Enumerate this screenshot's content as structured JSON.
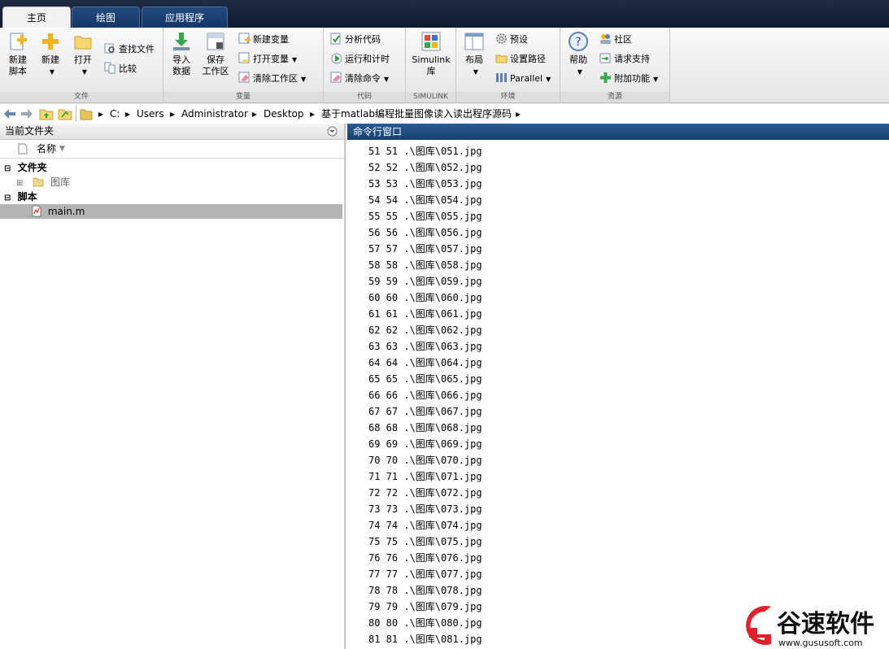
{
  "tabs": [
    {
      "label": "主页",
      "active": true
    },
    {
      "label": "绘图",
      "active": false
    },
    {
      "label": "应用程序",
      "active": false
    }
  ],
  "ribbon": {
    "file": {
      "group_label": "文件",
      "new_script": "新建\n脚本",
      "new": "新建",
      "open": "打开",
      "find_files": "查找文件",
      "compare": "比较"
    },
    "variable": {
      "group_label": "变量",
      "import_data": "导入\n数据",
      "save_workspace": "保存\n工作区",
      "new_variable": "新建变量",
      "open_variable": "打开变量",
      "clear_workspace": "清除工作区"
    },
    "code": {
      "group_label": "代码",
      "analyze_code": "分析代码",
      "run_and_time": "运行和计时",
      "clear_commands": "清除命令"
    },
    "simulink": {
      "group_label": "SIMULINK",
      "simulink_library": "Simulink\n库"
    },
    "environment": {
      "group_label": "环境",
      "layout": "布局",
      "preferences": "预设",
      "set_path": "设置路径",
      "parallel": "Parallel"
    },
    "resources": {
      "group_label": "资源",
      "help": "帮助",
      "community": "社区",
      "request_support": "请求支持",
      "add_ons": "附加功能"
    }
  },
  "address": {
    "crumbs": [
      "C:",
      "Users",
      "Administrator",
      "Desktop",
      "基于matlab编程批量图像读入读出程序源码"
    ]
  },
  "current_folder": {
    "title": "当前文件夹",
    "column_name": "名称",
    "section_folders": "文件夹",
    "folder_item": "图库",
    "section_scripts": "脚本",
    "script_item": "main.m"
  },
  "command_window": {
    "title": "命令行窗口",
    "lines": [
      "51 51 .\\图库\\051.jpg",
      "52 52 .\\图库\\052.jpg",
      "53 53 .\\图库\\053.jpg",
      "54 54 .\\图库\\054.jpg",
      "55 55 .\\图库\\055.jpg",
      "56 56 .\\图库\\056.jpg",
      "57 57 .\\图库\\057.jpg",
      "58 58 .\\图库\\058.jpg",
      "59 59 .\\图库\\059.jpg",
      "60 60 .\\图库\\060.jpg",
      "61 61 .\\图库\\061.jpg",
      "62 62 .\\图库\\062.jpg",
      "63 63 .\\图库\\063.jpg",
      "64 64 .\\图库\\064.jpg",
      "65 65 .\\图库\\065.jpg",
      "66 66 .\\图库\\066.jpg",
      "67 67 .\\图库\\067.jpg",
      "68 68 .\\图库\\068.jpg",
      "69 69 .\\图库\\069.jpg",
      "70 70 .\\图库\\070.jpg",
      "71 71 .\\图库\\071.jpg",
      "72 72 .\\图库\\072.jpg",
      "73 73 .\\图库\\073.jpg",
      "74 74 .\\图库\\074.jpg",
      "75 75 .\\图库\\075.jpg",
      "76 76 .\\图库\\076.jpg",
      "77 77 .\\图库\\077.jpg",
      "78 78 .\\图库\\078.jpg",
      "79 79 .\\图库\\079.jpg",
      "80 80 .\\图库\\080.jpg",
      "81 81 .\\图库\\081.jpg"
    ]
  },
  "watermark": {
    "brand": "谷速软件",
    "url": "www.gususoft.com"
  },
  "colors": {
    "tab_strip": "#14233b",
    "cmd_title": "#1f4c80",
    "selected_row": "#b5b5b5",
    "watermark_red": "#e0202a"
  }
}
